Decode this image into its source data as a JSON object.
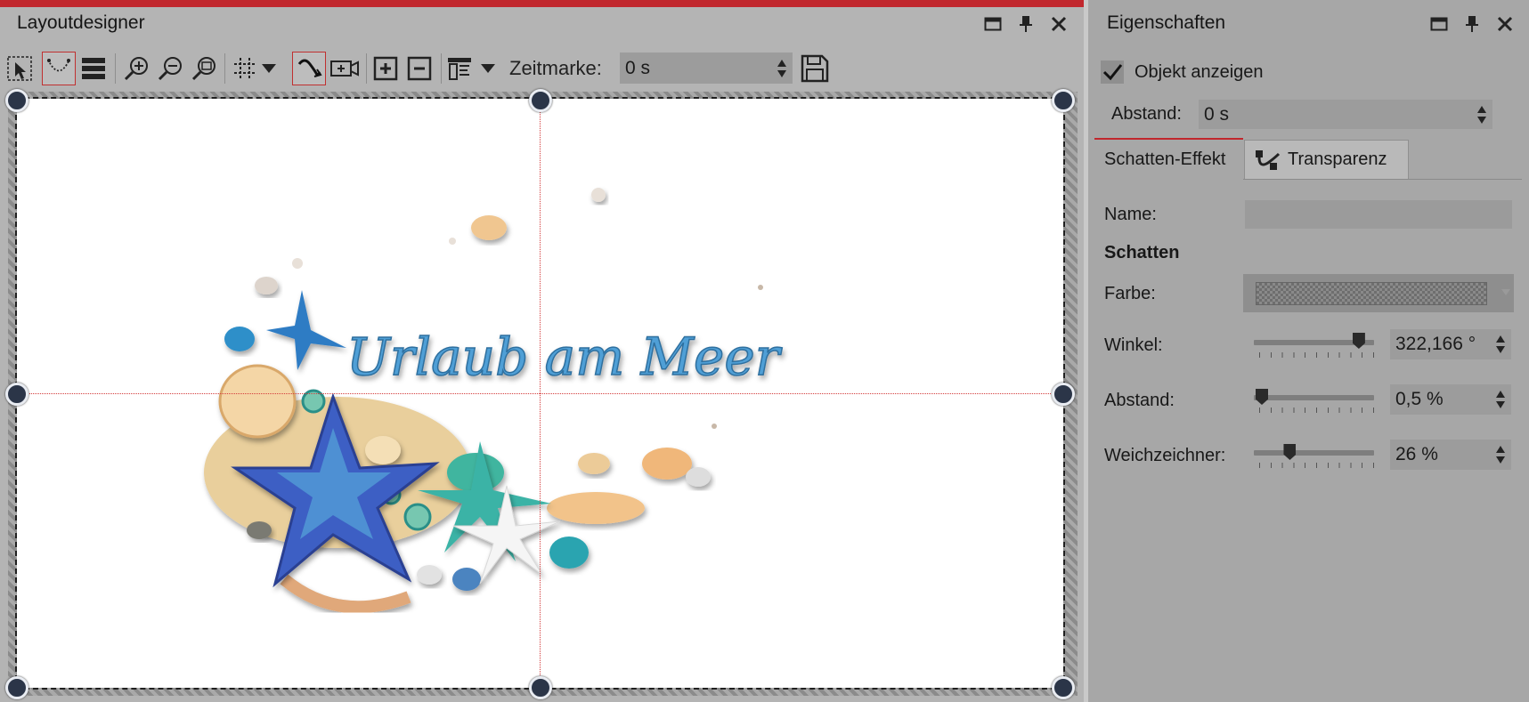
{
  "layoutdesigner": {
    "title": "Layoutdesigner",
    "zeitmarke_label": "Zeitmarke:",
    "zeitmarke_value": "0 s"
  },
  "canvas": {
    "title_art_text": "Urlaub am Meer"
  },
  "properties": {
    "title": "Eigenschaften",
    "show_object_label": "Objekt anzeigen",
    "show_object_checked": true,
    "abstand_label": "Abstand:",
    "abstand_value": "0 s",
    "tabs": [
      {
        "label": "Schatten-Effekt",
        "active": true
      },
      {
        "label": "Transparenz",
        "active": false
      }
    ],
    "name_label": "Name:",
    "name_value": "",
    "section_heading": "Schatten",
    "farbe_label": "Farbe:",
    "winkel_label": "Winkel:",
    "winkel_value": "322,166 °",
    "winkel_fraction": 0.9,
    "shadow_abstand_label": "Abstand:",
    "shadow_abstand_value": "0,5 %",
    "shadow_abstand_fraction": 0.0,
    "weichzeichner_label": "Weichzeichner:",
    "weichzeichner_value": "26 %",
    "weichzeichner_fraction": 0.26
  },
  "colors": {
    "accent_red": "#c1272d",
    "handle_fill": "#2b3548",
    "guide_red": "#d43a3a",
    "title_blue": "#4f9fd6"
  }
}
